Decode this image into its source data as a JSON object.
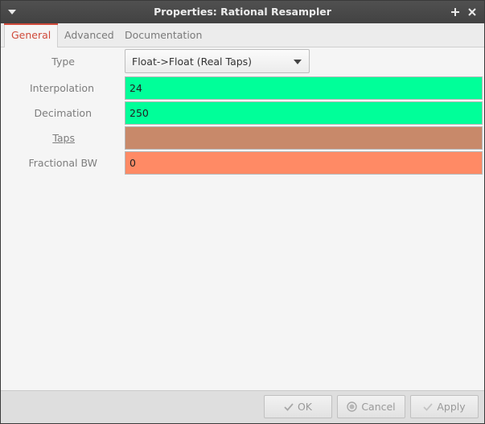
{
  "window": {
    "title": "Properties: Rational Resampler"
  },
  "tabs": [
    {
      "label": "General",
      "active": true
    },
    {
      "label": "Advanced",
      "active": false
    },
    {
      "label": "Documentation",
      "active": false
    }
  ],
  "form": {
    "type": {
      "label": "Type",
      "value": "Float->Float (Real Taps)"
    },
    "interpolation": {
      "label": "Interpolation",
      "value": "24",
      "color": "#00ff99"
    },
    "decimation": {
      "label": "Decimation",
      "value": "250",
      "color": "#00ff99"
    },
    "taps": {
      "label": "Taps",
      "value": "",
      "color": "#c8896a"
    },
    "fractional_bw": {
      "label": "Fractional BW",
      "value": "0",
      "color": "#ff8a65"
    }
  },
  "footer": {
    "ok_label": "OK",
    "cancel_label": "Cancel",
    "apply_label": "Apply"
  },
  "icons": {
    "menu": "chevron-down-icon",
    "maximize": "plus-icon",
    "close": "close-icon",
    "ok": "checkmark-icon",
    "cancel": "cancel-icon",
    "apply": "checkmark-icon"
  }
}
